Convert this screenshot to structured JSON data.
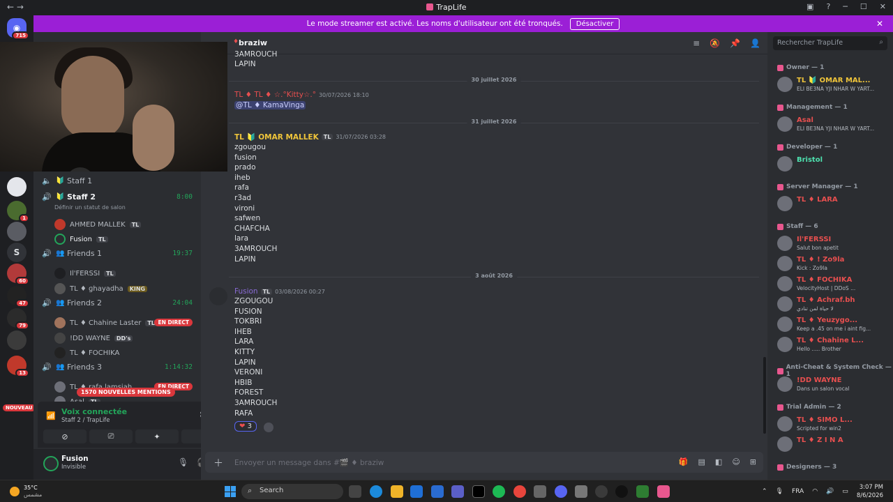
{
  "window": {
    "title": "TrapLife",
    "controls": [
      "▣",
      "?",
      "─",
      "☐",
      "✕"
    ]
  },
  "banner": {
    "text": "Le mode streamer est activé. Les noms d'utilisateur ont été tronqués.",
    "button": "Désactiver"
  },
  "servers": [
    {
      "label": "",
      "badge": "715"
    },
    {
      "label": "",
      "badge": ""
    },
    {
      "label": "",
      "badge": "1"
    },
    {
      "label": "",
      "badge": ""
    },
    {
      "label": "S",
      "badge": ""
    },
    {
      "label": "",
      "badge": "60"
    },
    {
      "label": "",
      "badge": "47"
    },
    {
      "label": "",
      "badge": "79"
    },
    {
      "label": "",
      "badge": ""
    },
    {
      "label": "",
      "badge": "13"
    }
  ],
  "nouveau": "NOUVEAU",
  "channels": {
    "staff1": {
      "name": "Staff 1"
    },
    "staff2": {
      "name": "Staff 2",
      "timer": "8:00",
      "status": "Définir un statut de salon"
    },
    "staff2_members": [
      {
        "name": "AHMED MALLEK",
        "tag": "TL"
      },
      {
        "name": "Fusion",
        "tag": "TL"
      }
    ],
    "friends1": {
      "name": "Friends 1",
      "timer": "19:37"
    },
    "friends1_members": [
      {
        "name": "Il'FERSSI",
        "tag": "TL"
      },
      {
        "name": "TL ♦ ɡhayadha",
        "tag": "KING"
      }
    ],
    "friends2": {
      "name": "Friends 2",
      "timer": "24:04"
    },
    "friends2_members": [
      {
        "name": "TL ♦ Chahine Laster",
        "tag": "TL",
        "live": "EN DIRECT"
      },
      {
        "name": "!DD WAYNE",
        "tag": "DD's"
      },
      {
        "name": "TL ♦ FOCHIKA",
        "tag": ""
      }
    ],
    "friends3": {
      "name": "Friends 3",
      "timer": "1:14:32"
    },
    "friends3_members": [
      {
        "name": "TL ♦ rafa lamsiah",
        "live": "EN DIRECT"
      },
      {
        "name": "Asal",
        "tag": "TL"
      }
    ]
  },
  "mentions_pill": "1570 NOUVELLES MENTIONS",
  "voice": {
    "status": "Voix connectée",
    "channel": "Staff 2 / TrapLife"
  },
  "user": {
    "name": "Fusion",
    "status": "Invisible"
  },
  "chat": {
    "channel": "braziw",
    "top_lines": [
      "3AMROUCH",
      "LAPIN"
    ],
    "date1": "30 juillet 2026",
    "msg1": {
      "author": "TL ♦ TL ♦ ☆.°Kitty☆.°",
      "time": "30/07/2026 18:10",
      "mention": "@TL ♦ KamaVinga"
    },
    "date2": "31 juillet 2026",
    "msg2": {
      "author": "TL 🔰 OMAR MALLEK",
      "tag": "TL",
      "time": "31/07/2026 03:28",
      "lines": [
        "zgougou",
        "fusion",
        "prado",
        "iheb",
        "rafa",
        "r3ad",
        "vironi",
        "safwen",
        "CHAFCHA",
        "lara",
        "3AMROUCH",
        "LAPIN"
      ]
    },
    "date3": "3 août 2026",
    "msg3": {
      "author": "Fusion",
      "tag": "TL",
      "time": "03/08/2026 00:27",
      "lines": [
        "ZGOUGOU",
        "FUSION",
        "TOKBRI",
        "IHEB",
        "LARA",
        "KITTY",
        "LAPIN",
        "VERONI",
        "HBIB",
        "FOREST",
        "3AMROUCH",
        "RAFA"
      ]
    },
    "reaction": {
      "emoji": "❤",
      "count": "3"
    },
    "composer_placeholder": "Envoyer un message dans #🎬 ♦ braziw"
  },
  "members": {
    "search_placeholder": "Rechercher TrapLife",
    "groups": [
      {
        "title": "Owner — 1",
        "members": [
          {
            "name": "TL 🔰 OMAR MAL...",
            "status": "ELI BE3NA YJI NHAR W YART...",
            "color": "#f0c53a"
          }
        ]
      },
      {
        "title": "Management — 1",
        "members": [
          {
            "name": "Asal",
            "status": "ELI BE3NA YJI NHAR W YART...",
            "color": "#e84f4f"
          }
        ]
      },
      {
        "title": "Developer — 1",
        "members": [
          {
            "name": "Bristol",
            "status": "",
            "color": "#4ee3b0"
          }
        ]
      },
      {
        "title": "Server Manager — 1",
        "members": [
          {
            "name": "TL ♦ LARA",
            "status": "",
            "color": "#e84f4f"
          }
        ]
      },
      {
        "title": "Staff — 6",
        "members": [
          {
            "name": "Il'FERSSI",
            "status": "Salut bon apetit",
            "color": "#e84f4f"
          },
          {
            "name": "TL ♦ ! Zo9la",
            "status": "Kick : Zo9la",
            "color": "#e84f4f"
          },
          {
            "name": "TL ♦ FOCHIKA",
            "status": "VelocityHost | DDoS ...",
            "color": "#e84f4f"
          },
          {
            "name": "TL ♦ Achraf.bh",
            "status": "لا حياة لمن تنادي",
            "color": "#e84f4f"
          },
          {
            "name": "TL ♦ Yeuzygo...",
            "status": "Keep a .45 on me i aint fig...",
            "color": "#e84f4f"
          },
          {
            "name": "TL ♦ Chahine L...",
            "status": "Hello ..... Brother",
            "color": "#e84f4f"
          }
        ]
      },
      {
        "title": "Anti-Cheat & System Check — 1",
        "members": [
          {
            "name": "!DD WAYNE",
            "status": "Dans un salon vocal",
            "color": "#e84f4f"
          }
        ]
      },
      {
        "title": "Trial Admin — 2",
        "members": [
          {
            "name": "TL ♦ SIMO L...",
            "status": "Scripted for win2",
            "color": "#e84f4f"
          },
          {
            "name": "TL ♦ Z I N A",
            "status": "",
            "color": "#e84f4f"
          }
        ]
      },
      {
        "title": "Designers — 3",
        "members": []
      }
    ]
  },
  "taskbar": {
    "temp": "35°C",
    "weather": "مشمس",
    "search": "Search",
    "lang": "FRA",
    "time": "3:07 PM",
    "date": "8/6/2026"
  }
}
